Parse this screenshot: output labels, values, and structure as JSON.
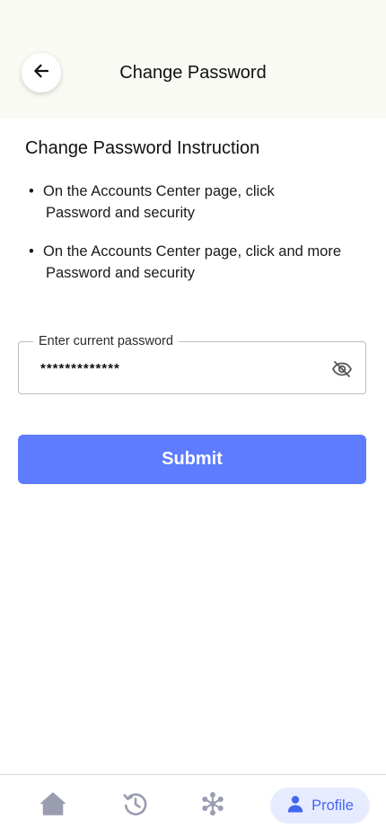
{
  "header": {
    "title": "Change Password",
    "back_icon": "arrow-left-icon"
  },
  "instructions": {
    "title": "Change Password Instruction",
    "items": [
      {
        "bullet": "•",
        "line1": "On the Accounts Center page, click",
        "line2": "Password and security"
      },
      {
        "bullet": "•",
        "line1": "On the Accounts Center page, click and more",
        "line2": "Password and security"
      }
    ]
  },
  "password_field": {
    "label": "Enter current password",
    "value": "*************",
    "visibility_icon": "eye-off-icon"
  },
  "submit": {
    "label": "Submit"
  },
  "bottom_nav": {
    "items": [
      {
        "icon": "home-icon"
      },
      {
        "icon": "history-icon"
      },
      {
        "icon": "cluster-icon"
      },
      {
        "icon": "person-icon",
        "label": "Profile",
        "active": true
      }
    ]
  },
  "colors": {
    "header_bg": "#fafaf5",
    "accent": "#5d7cff",
    "active_nav_bg": "#e6ebff",
    "active_nav_text": "#4466ee",
    "inactive_icon": "#9a9cb0"
  }
}
